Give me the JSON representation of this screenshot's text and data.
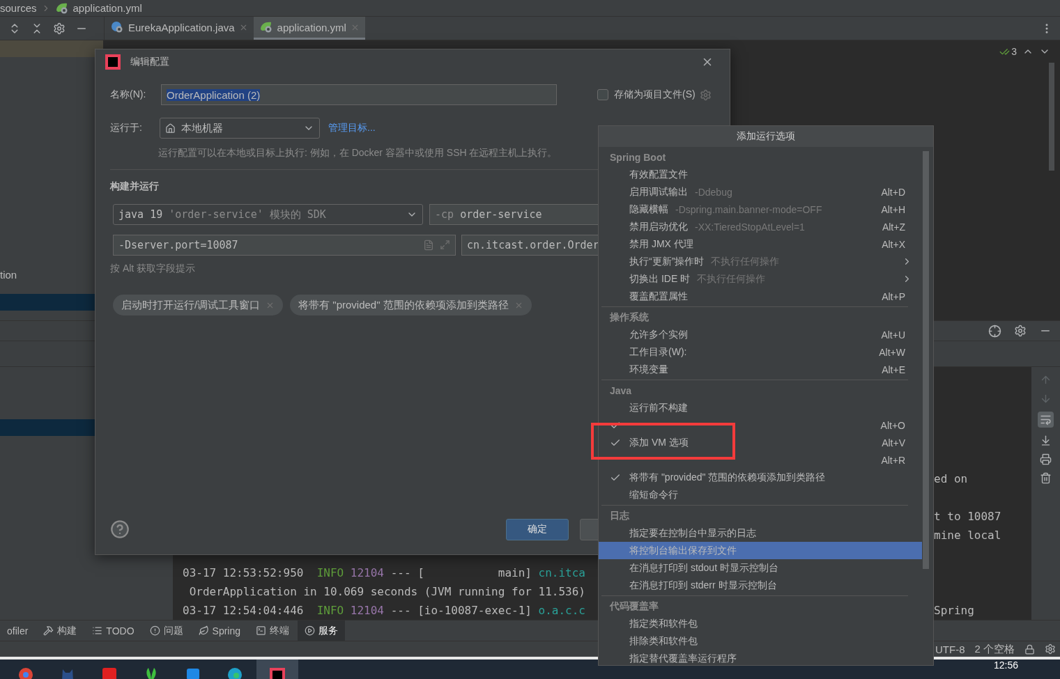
{
  "breadcrumb": {
    "folder": "sources",
    "file": "application.yml"
  },
  "editor_tabs": [
    {
      "label": "EurekaApplication.java",
      "kind": "java",
      "selected": false
    },
    {
      "label": "application.yml",
      "kind": "yaml",
      "selected": true
    }
  ],
  "editor": {
    "inspection_count": "3"
  },
  "project_panel": {
    "label": "tion"
  },
  "console": {
    "rows": [
      {
        "right": "ed on"
      },
      {},
      {
        "right": "t to 10087"
      },
      {
        "right": "mine local"
      },
      {},
      {
        "left": [
          {
            "text": "03-17 12:53:52:950  ",
            "kind": "plain"
          },
          {
            "text": "INFO ",
            "kind": "info"
          },
          {
            "text": "12104",
            "kind": "pid"
          },
          {
            "text": " --- [           main] ",
            "kind": "plain"
          },
          {
            "text": "cn.itca",
            "kind": "logger"
          }
        ]
      },
      {
        "left": [
          {
            "text": " OrderApplication in 10.069 seconds (JVM running for 11.536)",
            "kind": "plain"
          }
        ]
      },
      {
        "left": [
          {
            "text": "03-17 12:54:04:446  ",
            "kind": "plain"
          },
          {
            "text": "INFO ",
            "kind": "info"
          },
          {
            "text": "12104",
            "kind": "pid"
          },
          {
            "text": " --- [io-10087-exec-1] ",
            "kind": "plain"
          },
          {
            "text": "o.a.c.c",
            "kind": "logger"
          }
        ],
        "right": "Spring"
      }
    ]
  },
  "tool_strip": [
    {
      "label": "ofiler",
      "kind": "profiler",
      "selected": false
    },
    {
      "label": "构建",
      "kind": "build",
      "selected": false
    },
    {
      "label": "TODO",
      "kind": "todo",
      "selected": false
    },
    {
      "label": "问题",
      "kind": "problems",
      "selected": false
    },
    {
      "label": "Spring",
      "kind": "spring",
      "selected": false
    },
    {
      "label": "终端",
      "kind": "terminal",
      "selected": false
    },
    {
      "label": "服务",
      "kind": "services",
      "selected": true
    }
  ],
  "status_bar": {
    "encoding": "UTF-8",
    "indent": "2 个空格"
  },
  "taskbar": {
    "clock": "12:56",
    "apps": [
      {
        "kind": "browser",
        "selected": false
      },
      {
        "kind": "cat",
        "selected": false
      },
      {
        "kind": "red",
        "selected": false
      },
      {
        "kind": "plant",
        "selected": false
      },
      {
        "kind": "monitor",
        "selected": false
      },
      {
        "kind": "edge",
        "selected": false
      },
      {
        "kind": "ide",
        "selected": true
      }
    ]
  },
  "dialog": {
    "title": "编辑配置",
    "name_label": "名称(N):",
    "name_value": "OrderApplication (2)",
    "name_value_selected": true,
    "store_as_file": {
      "label": "存储为项目文件(S)",
      "checked": false
    },
    "run_on": {
      "label": "运行于:",
      "value": "本地机器",
      "link": "管理目标..."
    },
    "run_on_hint": "运行配置可以在本地或目标上执行: 例如，在 Docker 容器中或使用 SSH 在远程主机上执行。",
    "section": "构建并运行",
    "sdk": [
      {
        "text": "java 19 ",
        "kind": "plain"
      },
      {
        "text": "'order-service'",
        "kind": "string"
      },
      {
        "text": " 模块的 SDK",
        "kind": "dim"
      }
    ],
    "classpath": {
      "prefix": "-cp",
      "value": "order-service"
    },
    "vm_options": "-Dserver.port=10087",
    "main_class": "cn.itcast.order.Order",
    "field_hint": "按 Alt 获取字段提示",
    "chips": [
      "启动时打开运行/调试工具窗口",
      "将带有 \"provided\" 范围的依赖项添加到类路径"
    ],
    "ok_button": "确定"
  },
  "run_options_popup": {
    "title": "添加运行选项",
    "groups": [
      {
        "header": "Spring Boot",
        "items": [
          {
            "label": "有效配置文件",
            "checked": false,
            "selected": false,
            "submenu": false
          },
          {
            "label": "启用调试输出",
            "hint": "-Ddebug",
            "shortcut": "Alt+D",
            "checked": false,
            "selected": false,
            "submenu": false
          },
          {
            "label": "隐藏横幅",
            "hint": "-Dspring.main.banner-mode=OFF",
            "shortcut": "Alt+H",
            "checked": false,
            "selected": false,
            "submenu": false
          },
          {
            "label": "禁用启动优化",
            "hint": "-XX:TieredStopAtLevel=1",
            "shortcut": "Alt+Z",
            "checked": false,
            "selected": false,
            "submenu": false
          },
          {
            "label": "禁用 JMX 代理",
            "shortcut": "Alt+X",
            "checked": false,
            "selected": false,
            "submenu": false
          },
          {
            "label": "执行“更新”操作时",
            "hint": "不执行任何操作",
            "checked": false,
            "selected": false,
            "submenu": true
          },
          {
            "label": "切换出 IDE 时",
            "hint": "不执行任何操作",
            "checked": false,
            "selected": false,
            "submenu": true
          },
          {
            "label": "覆盖配置属性",
            "shortcut": "Alt+P",
            "checked": false,
            "selected": false,
            "submenu": false
          }
        ]
      },
      {
        "header": "操作系统",
        "items": [
          {
            "label": "允许多个实例",
            "shortcut": "Alt+U",
            "checked": false,
            "selected": false,
            "submenu": false
          },
          {
            "label": "工作目录(W):",
            "shortcut": "Alt+W",
            "checked": false,
            "selected": false,
            "submenu": false
          },
          {
            "label": "环境变量",
            "shortcut": "Alt+E",
            "checked": false,
            "selected": false,
            "submenu": false
          }
        ]
      },
      {
        "header": "Java",
        "items": [
          {
            "label": "运行前不构建",
            "checked": false,
            "selected": false,
            "submenu": false
          },
          {
            "shortcut": "Alt+O",
            "checked": true,
            "selected": false,
            "submenu": false
          },
          {
            "label": "添加 VM 选项",
            "shortcut": "Alt+V",
            "checked": true,
            "selected": false,
            "submenu": false
          },
          {
            "shortcut": "Alt+R",
            "checked": false,
            "selected": false,
            "submenu": false
          },
          {
            "label": "将带有 \"provided\" 范围的依赖项添加到类路径",
            "checked": true,
            "selected": false,
            "submenu": false
          },
          {
            "label": "缩短命令行",
            "checked": false,
            "selected": false,
            "submenu": false
          }
        ]
      },
      {
        "header": "日志",
        "items": [
          {
            "label": "指定要在控制台中显示的日志",
            "checked": false,
            "selected": false,
            "submenu": false
          },
          {
            "label": "将控制台输出保存到文件",
            "checked": false,
            "selected": true,
            "submenu": false
          },
          {
            "label": "在消息打印到 stdout 时显示控制台",
            "checked": false,
            "selected": false,
            "submenu": false
          },
          {
            "label": "在消息打印到 stderr 时显示控制台",
            "checked": false,
            "selected": false,
            "submenu": false
          }
        ]
      },
      {
        "header": "代码覆盖率",
        "items": [
          {
            "label": "指定类和软件包",
            "checked": false,
            "selected": false,
            "submenu": false
          },
          {
            "label": "排除类和软件包",
            "checked": false,
            "selected": false,
            "submenu": false
          },
          {
            "label": "指定替代覆盖率运行程序",
            "checked": false,
            "selected": false,
            "submenu": false
          }
        ]
      }
    ]
  }
}
